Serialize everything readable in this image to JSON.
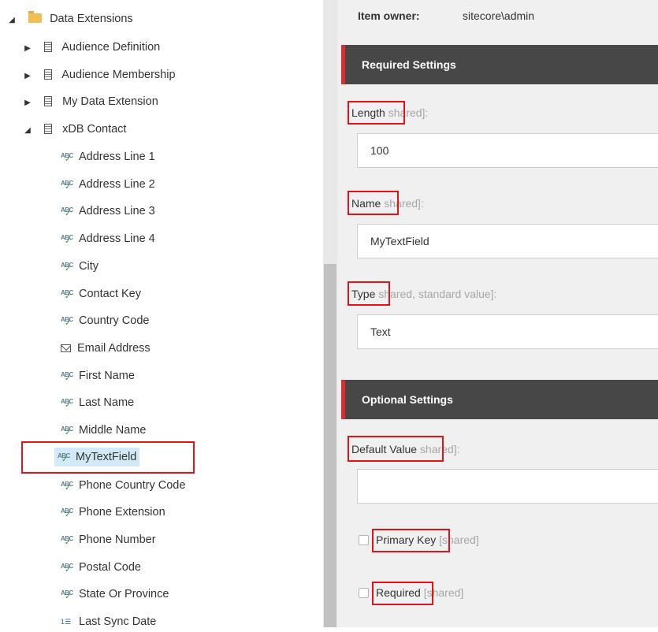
{
  "tree": {
    "root": {
      "label": "Data Extensions",
      "expanded": true
    },
    "tables": [
      {
        "label": "Audience Definition",
        "expanded": false
      },
      {
        "label": "Audience Membership",
        "expanded": false
      },
      {
        "label": "My Data Extension",
        "expanded": false
      },
      {
        "label": "xDB Contact",
        "expanded": true
      }
    ],
    "fields": [
      {
        "label": "Address Line 1",
        "icon": "abc-text-icon"
      },
      {
        "label": "Address Line 2",
        "icon": "abc-text-icon"
      },
      {
        "label": "Address Line 3",
        "icon": "abc-text-icon"
      },
      {
        "label": "Address Line 4",
        "icon": "abc-text-icon"
      },
      {
        "label": "City",
        "icon": "abc-text-icon"
      },
      {
        "label": "Contact Key",
        "icon": "abc-text-icon"
      },
      {
        "label": "Country Code",
        "icon": "abc-text-icon"
      },
      {
        "label": "Email Address",
        "icon": "email-icon"
      },
      {
        "label": "First Name",
        "icon": "abc-text-icon"
      },
      {
        "label": "Last Name",
        "icon": "abc-text-icon"
      },
      {
        "label": "Middle Name",
        "icon": "abc-text-icon"
      },
      {
        "label": "MyTextField",
        "icon": "abc-text-icon",
        "selected": true
      },
      {
        "label": "Phone Country Code",
        "icon": "abc-text-icon"
      },
      {
        "label": "Phone Extension",
        "icon": "abc-text-icon"
      },
      {
        "label": "Phone Number",
        "icon": "abc-text-icon"
      },
      {
        "label": "Postal Code",
        "icon": "abc-text-icon"
      },
      {
        "label": "State Or Province",
        "icon": "abc-text-icon"
      },
      {
        "label": "Last Sync Date",
        "icon": "number-icon"
      }
    ]
  },
  "details": {
    "owner_label": "Item owner:",
    "owner_value": "sitecore\\admin",
    "required_title": "Required Settings",
    "optional_title": "Optional Settings",
    "length": {
      "label": "Length",
      "meta": "shared]:",
      "value": "100"
    },
    "name": {
      "label": "Name",
      "meta": "shared]:",
      "value": "MyTextField"
    },
    "type": {
      "label": "Type",
      "meta": "shared, standard value]:",
      "value": "Text"
    },
    "default_value": {
      "label": "Default Value",
      "meta": "shared]:",
      "value": ""
    },
    "primary_key": {
      "label": "Primary Key",
      "meta": "[shared]",
      "checked": false
    },
    "required": {
      "label": "Required",
      "meta": "[shared]",
      "checked": false
    }
  },
  "colors": {
    "highlight_box": "#e1141b",
    "section_header": "#474747",
    "section_accent": "#dd2c2c",
    "selection_bg": "#d2eaf7"
  }
}
